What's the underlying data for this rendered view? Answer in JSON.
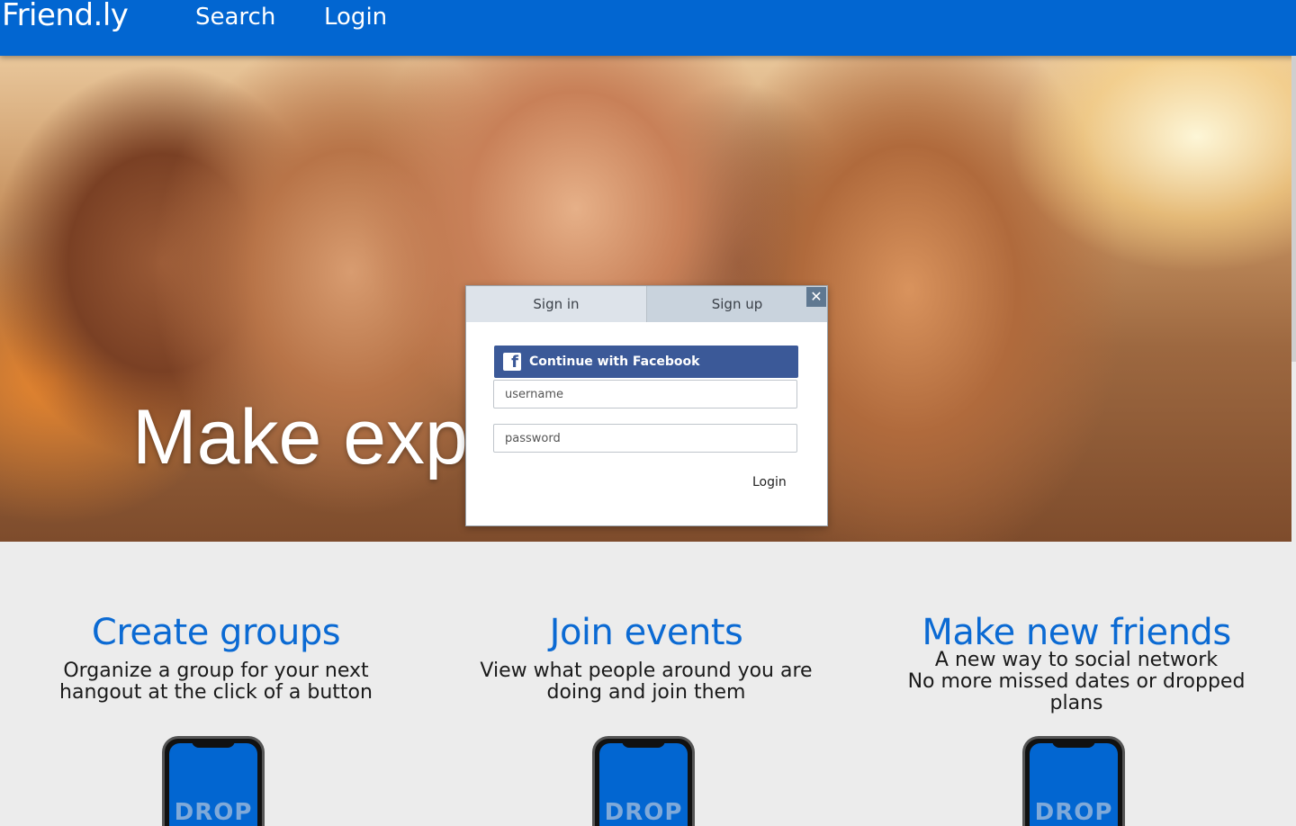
{
  "nav": {
    "brand": "Friend.ly",
    "search": "Search",
    "login": "Login"
  },
  "hero": {
    "headline": "Make exp"
  },
  "modal": {
    "tab_signin": "Sign in",
    "tab_signup": "Sign up",
    "close_symbol": "✕",
    "facebook_label": "Continue with Facebook",
    "facebook_icon_glyph": "f",
    "username_placeholder": "username",
    "password_placeholder": "password",
    "login_label": "Login"
  },
  "features": [
    {
      "title": "Create groups",
      "lines": [
        "Organize a group for your next",
        "hangout at the click of a button"
      ]
    },
    {
      "title": "Join events",
      "lines": [
        "View what people around you are",
        "doing and join them"
      ]
    },
    {
      "title": "Make new friends",
      "lines": [
        "A new way to social network",
        "No more missed dates or dropped",
        "plans"
      ]
    }
  ],
  "phone_text": "DROP",
  "colors": {
    "navbar": "#0266d1",
    "facebook": "#3b5998",
    "feature_title": "#0b6ad3",
    "background": "#ececec"
  }
}
